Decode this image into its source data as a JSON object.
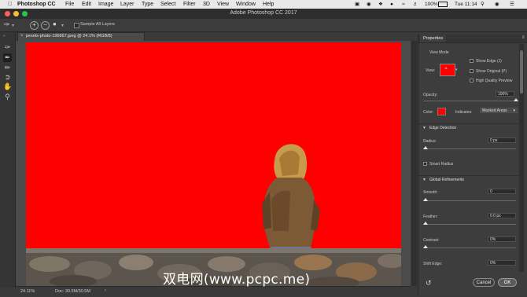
{
  "menubar": {
    "app_name": "Photoshop CC",
    "items": [
      "File",
      "Edit",
      "Image",
      "Layer",
      "Type",
      "Select",
      "Filter",
      "3D",
      "View",
      "Window",
      "Help"
    ],
    "battery": "100%",
    "clock": "Tue 11:14"
  },
  "window": {
    "title": "Adobe Photoshop CC 2017"
  },
  "options": {
    "sample_all_layers": "Sample All Layers"
  },
  "document": {
    "tab_title": "pexels-photo-196667.jpeg @ 24.1% (RGB/8)",
    "close_glyph": "×",
    "zoom": "24.11%",
    "doc_size": "Doc: 30.5M/30.5M",
    "status_arrow": "›"
  },
  "properties": {
    "tab": "Properties",
    "menu_glyph": "≡",
    "view_mode_label": "View Mode",
    "view_label": "View:",
    "show_edge": "Show Edge (J)",
    "show_original": "Show Original (P)",
    "high_quality_preview": "High Quality Preview",
    "opacity_label": "Opacity:",
    "opacity_value": "100%",
    "opacity_fraction": 1.0,
    "color_label": "Color:",
    "overlay_color": "#ff0000",
    "indicates_label": "Indicates:",
    "indicates_value": "Masked Areas",
    "edge_detection": {
      "title": "Edge Detection",
      "radius_label": "Radius:",
      "radius_value": "0 px",
      "smart_radius": "Smart Radius"
    },
    "global_refinements": {
      "title": "Global Refinements",
      "smooth_label": "Smooth:",
      "smooth_value": "0",
      "feather_label": "Feather:",
      "feather_value": "0.0 px",
      "contrast_label": "Contrast:",
      "contrast_value": "0%",
      "shift_edge_label": "Shift Edge:",
      "shift_edge_value": "0%"
    },
    "cancel": "Cancel",
    "ok": "OK"
  },
  "watermark": "双电网(www.pcpc.me)",
  "colors": {
    "canvas_overlay": "#ff0000",
    "panel_bg": "#3d3d3d",
    "ok_button": "#5a5a5a",
    "traffic_red": "#fe5f57",
    "traffic_yellow": "#febc2e",
    "traffic_green": "#28c840"
  }
}
